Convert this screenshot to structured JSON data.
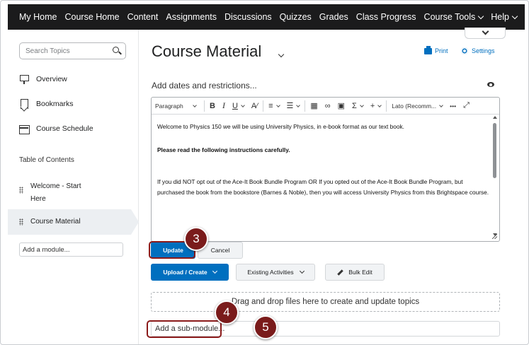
{
  "topnav": {
    "items": [
      {
        "label": "My Home"
      },
      {
        "label": "Course Home"
      },
      {
        "label": "Content"
      },
      {
        "label": "Assignments"
      },
      {
        "label": "Discussions"
      },
      {
        "label": "Quizzes"
      },
      {
        "label": "Grades"
      },
      {
        "label": "Class Progress"
      },
      {
        "label": "Course Tools",
        "has_dropdown": true
      },
      {
        "label": "Help",
        "has_dropdown": true
      }
    ]
  },
  "sidebar": {
    "search_placeholder": "Search Topics",
    "items": [
      {
        "label": "Overview",
        "icon": "overview-icon"
      },
      {
        "label": "Bookmarks",
        "icon": "bookmark-icon"
      },
      {
        "label": "Course Schedule",
        "icon": "calendar-icon"
      }
    ],
    "toc_label": "Table of Contents",
    "toc_items": [
      {
        "line1": "Welcome - Start",
        "line2": "Here"
      },
      {
        "label": "Course Material",
        "selected": true
      }
    ],
    "add_module_label": "Add a module..."
  },
  "main": {
    "title": "Course Material",
    "print_label": "Print",
    "settings_label": "Settings",
    "add_dates_label": "Add dates and restrictions...",
    "editor": {
      "toolbar": {
        "paragraph": "Paragraph",
        "font": "Lato (Recomm...",
        "more": "•••"
      },
      "paragraphs": [
        {
          "text": "Welcome to Physics 150 we will be using University Physics, in e-book format as our text book.",
          "bold": false
        },
        {
          "text": "Please read the following instructions carefully.",
          "bold": true
        },
        {
          "text": "If you did NOT opt out of the Ace-It Book Bundle Program OR If you opted out of the Ace-It Book Bundle Program, but purchased the book from the bookstore (Barnes & Noble), then you will access University Physics from this Brightspace course.",
          "bold": false
        }
      ]
    },
    "update_label": "Update",
    "cancel_label": "Cancel",
    "upload_label": "Upload / Create",
    "existing_label": "Existing Activities",
    "bulk_label": "Bulk Edit",
    "dropzone_label": "Drag and drop files here to create and update topics",
    "add_submodule_label": "Add a sub-module..."
  },
  "callouts": [
    {
      "number": "3"
    },
    {
      "number": "4"
    },
    {
      "number": "5"
    }
  ],
  "colors": {
    "nav_bg": "#1b1b1c",
    "primary": "#006fbf",
    "callout": "#7a1b1b",
    "highlight": "#8b1a1a"
  }
}
